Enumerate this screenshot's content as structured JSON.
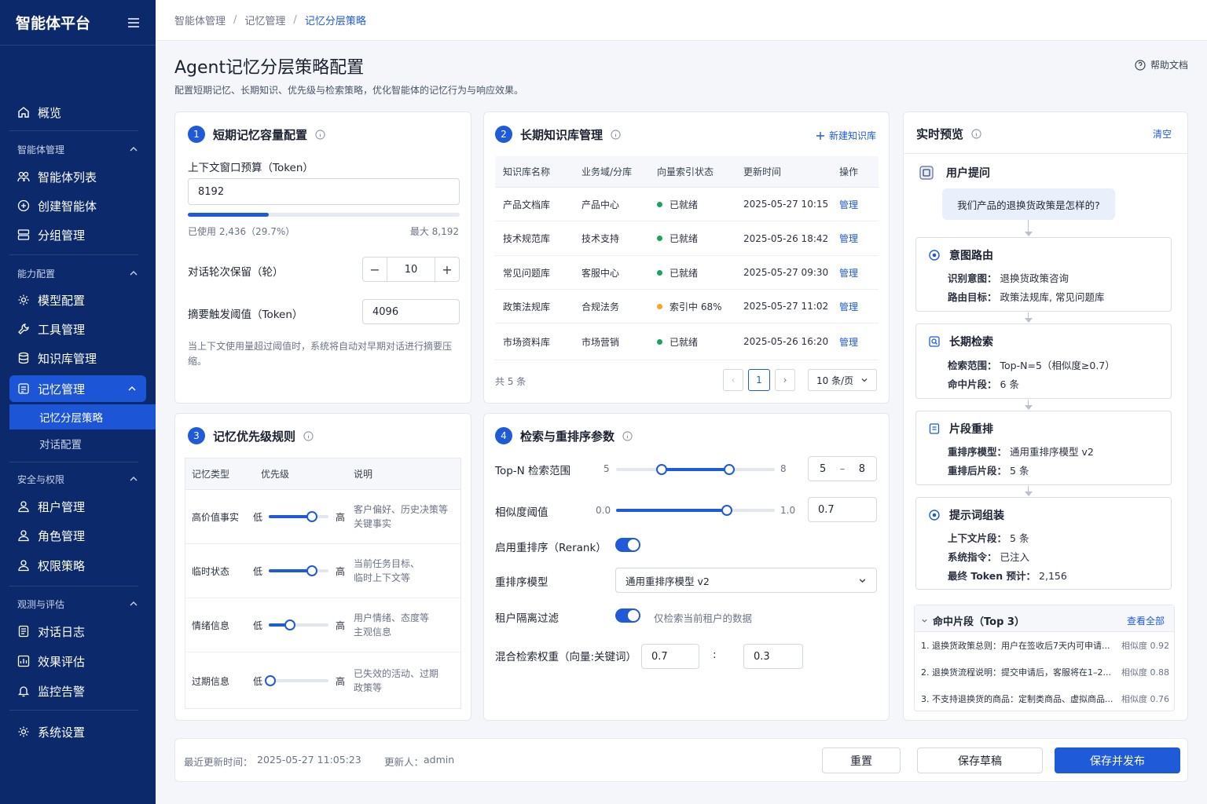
{
  "app": {
    "title": "智能体平台"
  },
  "sidebar": {
    "overview": "概览",
    "groups": {
      "agent": "智能体管理",
      "capability": "能力配置",
      "security": "安全与权限",
      "observe": "观测与评估"
    },
    "items": {
      "agent_list": "智能体列表",
      "create_agent": "创建智能体",
      "group_mgmt": "分组管理",
      "model_config": "模型配置",
      "tool_mgmt": "工具管理",
      "kb_mgmt": "知识库管理",
      "memory_mgmt": "记忆管理",
      "memory_strategy": "记忆分层策略",
      "dialog_config": "对话配置",
      "tenant_mgmt": "租户管理",
      "role_mgmt": "角色管理",
      "perm_policy": "权限策略",
      "dialog_log": "对话日志",
      "eval": "效果评估",
      "monitor": "监控告警",
      "settings": "系统设置"
    }
  },
  "breadcrumb": [
    "智能体管理",
    "记忆管理",
    "记忆分层策略"
  ],
  "page": {
    "title": "Agent记忆分层策略配置",
    "desc": "配置短期记忆、长期知识、优先级与检索策略，优化智能体的记忆行为与响应效果。",
    "help": "帮助文档"
  },
  "short_term": {
    "num": "1",
    "title": "短期记忆容量配置",
    "budget_label": "上下文窗口预算（Token）",
    "budget_value": "8192",
    "usage_fraction": 0.297,
    "used_text": "已使用 2,436（29.7%）",
    "max_text": "最大 8,192",
    "rounds_label": "对话轮次保留（轮）",
    "rounds_value": "10",
    "summary_label": "摘要触发阈值（Token）",
    "summary_value": "4096",
    "hint": "当上下文使用量超过阈值时，系统将自动对早期对话进行摘要压缩。"
  },
  "long_term": {
    "num": "2",
    "title": "长期知识库管理",
    "new_kb": "新建知识库",
    "columns": [
      "知识库名称",
      "业务域/分库",
      "向量索引状态",
      "更新时间",
      "操作"
    ],
    "rows": [
      {
        "name": "产品文档库",
        "domain": "产品中心",
        "status": "已就绪",
        "status_color": "#1aa35c",
        "time": "2025-05-27 10:15",
        "action": "管理"
      },
      {
        "name": "技术规范库",
        "domain": "技术支持",
        "status": "已就绪",
        "status_color": "#1aa35c",
        "time": "2025-05-26 18:42",
        "action": "管理"
      },
      {
        "name": "常见问题库",
        "domain": "客服中心",
        "status": "已就绪",
        "status_color": "#1aa35c",
        "time": "2025-05-27 09:30",
        "action": "管理"
      },
      {
        "name": "政策法规库",
        "domain": "合规法务",
        "status": "索引中 68%",
        "status_color": "#f5a623",
        "time": "2025-05-27 11:02",
        "action": "管理"
      },
      {
        "name": "市场资料库",
        "domain": "市场营销",
        "status": "已就绪",
        "status_color": "#1aa35c",
        "time": "2025-05-26 16:20",
        "action": "管理"
      }
    ],
    "total": "共 5 条",
    "page": "1",
    "page_size": "10 条/页"
  },
  "priority": {
    "num": "3",
    "title": "记忆优先级规则",
    "columns": [
      "记忆类型",
      "优先级",
      "说明"
    ],
    "low": "低",
    "high": "高",
    "rows": [
      {
        "type": "高价值事实",
        "level": 0.72,
        "desc1": "客户偏好、历史决策等",
        "desc2": "关键事实"
      },
      {
        "type": "临时状态",
        "level": 0.72,
        "desc1": "当前任务目标、",
        "desc2": "临时上下文等"
      },
      {
        "type": "情绪信息",
        "level": 0.35,
        "desc1": "用户情绪、态度等",
        "desc2": "主观信息"
      },
      {
        "type": "过期信息",
        "level": 0.02,
        "desc1": "已失效的活动、过期",
        "desc2": "政策等"
      }
    ]
  },
  "retrieval": {
    "num": "4",
    "title": "检索与重排序参数",
    "topn_label": "Top-N 检索范围",
    "topn_min": "5",
    "topn_max": "8",
    "topn_low": 5,
    "topn_high": 8,
    "topn_range": [
      3,
      10
    ],
    "topn_from": "5",
    "topn_dash": "–",
    "topn_to": "8",
    "sim_label": "相似度阈值",
    "sim_min": "0.0",
    "sim_max": "1.0",
    "sim_level": 0.7,
    "sim_value": "0.7",
    "rerank_label": "启用重排序（Rerank）",
    "model_label": "重排序模型",
    "model_value": "通用重排序模型 v2",
    "tenant_label": "租户隔离过滤",
    "tenant_hint": "仅检索当前租户的数据",
    "hybrid_label": "混合检索权重（向量:关键词）",
    "hybrid_vec": "0.7",
    "hybrid_colon": ":",
    "hybrid_kw": "0.3"
  },
  "preview": {
    "title": "实时预览",
    "clear": "清空",
    "question_label": "用户提问",
    "question": "我们产品的退换货政策是怎样的?",
    "intent": {
      "title": "意图路由",
      "k1": "识别意图：",
      "v1": "退换货政策咨询",
      "k2": "路由目标：",
      "v2": "政策法规库, 常见问题库"
    },
    "retrieve": {
      "title": "长期检索",
      "k1": "检索范围：",
      "v1": "Top-N=5（相似度≥0.7）",
      "k2": "命中片段：",
      "v2": "6 条"
    },
    "rerank": {
      "title": "片段重排",
      "k1": "重排序模型：",
      "v1": "通用重排序模型 v2",
      "k2": "重排后片段：",
      "v2": "5 条"
    },
    "prompt": {
      "title": "提示词组装",
      "k1": "上下文片段：",
      "v1": "5 条",
      "k2": "系统指令：",
      "v2": "已注入",
      "k3": "最终 Token 预计：",
      "v3": "2,156"
    },
    "hits_title": "命中片段（Top 3）",
    "view_all": "查看全部",
    "hits": [
      {
        "text": "1. 退换货政策总则：用户在签收后7天内可申请...",
        "score": "相似度 0.92"
      },
      {
        "text": "2. 退换货流程说明：提交申请后，客服将在1–2...",
        "score": "相似度 0.88"
      },
      {
        "text": "3. 不支持退换货的商品：定制类商品、虚拟商品...",
        "score": "相似度 0.76"
      }
    ]
  },
  "footer": {
    "updated_label": "最近更新时间：",
    "updated_value": "2025-05-27 11:05:23",
    "updater_label": "更新人：",
    "updater_value": "admin",
    "reset": "重置",
    "save_draft": "保存草稿",
    "publish": "保存并发布"
  }
}
